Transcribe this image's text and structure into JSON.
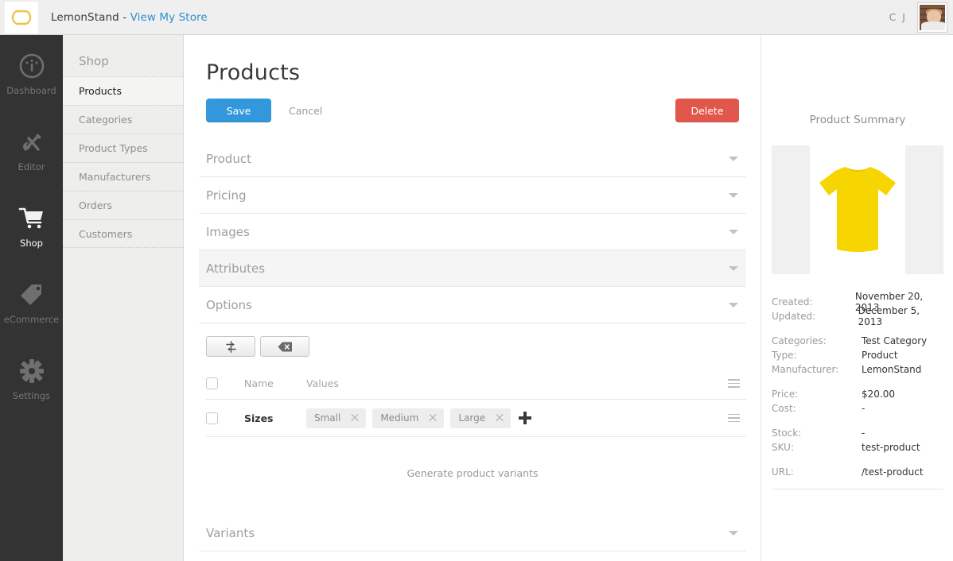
{
  "topbar": {
    "logo_icon": "lemon-outline-icon",
    "brand": "LemonStand - ",
    "brand_link": "View My Store",
    "user_initials": "C J",
    "avatar_icon": "user-avatar-photo"
  },
  "rail": {
    "items": [
      {
        "label": "Dashboard",
        "icon": "gauge-icon",
        "active": false
      },
      {
        "label": "Editor",
        "icon": "wrench-pencil-icon",
        "active": false
      },
      {
        "label": "Shop",
        "icon": "shopping-cart-icon",
        "active": true
      },
      {
        "label": "eCommerce",
        "icon": "tag-icon",
        "active": false
      },
      {
        "label": "Settings",
        "icon": "gear-icon",
        "active": false
      }
    ]
  },
  "subnav": {
    "title": "Shop",
    "items": [
      {
        "label": "Products",
        "active": true
      },
      {
        "label": "Categories",
        "active": false
      },
      {
        "label": "Product Types",
        "active": false
      },
      {
        "label": "Manufacturers",
        "active": false
      },
      {
        "label": "Orders",
        "active": false
      },
      {
        "label": "Customers",
        "active": false
      }
    ]
  },
  "main": {
    "page_title": "Products",
    "save_label": "Save",
    "cancel_label": "Cancel",
    "delete_label": "Delete",
    "accordion": [
      {
        "label": "Product",
        "highlighted": false
      },
      {
        "label": "Pricing",
        "highlighted": false
      },
      {
        "label": "Images",
        "highlighted": false
      },
      {
        "label": "Attributes",
        "highlighted": true
      },
      {
        "label": "Options",
        "highlighted": false
      }
    ],
    "toolbar": [
      {
        "icon": "add-row-arrow-icon"
      },
      {
        "icon": "backspace-delete-icon"
      }
    ],
    "table": {
      "headers": [
        "Name",
        "Values"
      ],
      "rows": [
        {
          "name": "Sizes",
          "values": [
            "Small",
            "Medium",
            "Large"
          ]
        }
      ],
      "add_value_icon": "plus-icon",
      "row_menu_icon": "hamburger-icon"
    },
    "generate_variants_label": "Generate product variants",
    "variants_section": {
      "label": "Variants"
    }
  },
  "summary": {
    "title": "Product Summary",
    "product_image_icon": "yellow-tshirt-image",
    "groups": [
      [
        {
          "key": "Created:",
          "value": "November 20, 2013"
        },
        {
          "key": "Updated:",
          "value": "December 5, 2013"
        }
      ],
      [
        {
          "key": "Categories:",
          "value": "Test Category"
        },
        {
          "key": "Type:",
          "value": "Product"
        },
        {
          "key": "Manufacturer:",
          "value": "LemonStand"
        }
      ],
      [
        {
          "key": "Price:",
          "value": "$20.00"
        },
        {
          "key": "Cost:",
          "value": "-"
        }
      ],
      [
        {
          "key": "Stock:",
          "value": "-"
        },
        {
          "key": "SKU:",
          "value": "test-product"
        }
      ],
      [
        {
          "key": "URL:",
          "value": "/test-product"
        }
      ]
    ]
  },
  "colors": {
    "save_blue": "#3398db",
    "delete_red": "#e2574c",
    "link_blue": "#2f8fce",
    "rail_dark": "#333333",
    "subnav_gray": "#eeeeed",
    "logo_yellow": "#edc447",
    "shirt_yellow": "#f6d500"
  }
}
